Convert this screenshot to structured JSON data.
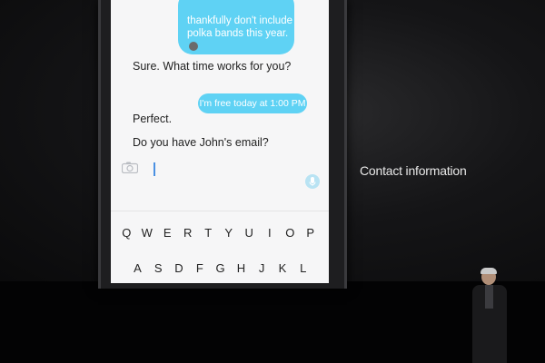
{
  "conversation": {
    "sent_top_text": "thankfully don't include polka bands this year.",
    "received_1": "Sure. What time works for you?",
    "sent_2": "I'm free today at 1:00 PM",
    "received_2": "Perfect.",
    "received_3": "Do you have John's email?"
  },
  "keyboard": {
    "row1": [
      "Q",
      "W",
      "E",
      "R",
      "T",
      "Y",
      "U",
      "I",
      "O",
      "P"
    ],
    "row2": [
      "A",
      "S",
      "D",
      "F",
      "G",
      "H",
      "J",
      "K",
      "L"
    ]
  },
  "stage": {
    "side_label": "Contact information"
  },
  "colors": {
    "bubble_outgoing": "#5fd2f4",
    "screen_bg": "#f6f6f7",
    "stage_bg": "#0b0b0d"
  }
}
